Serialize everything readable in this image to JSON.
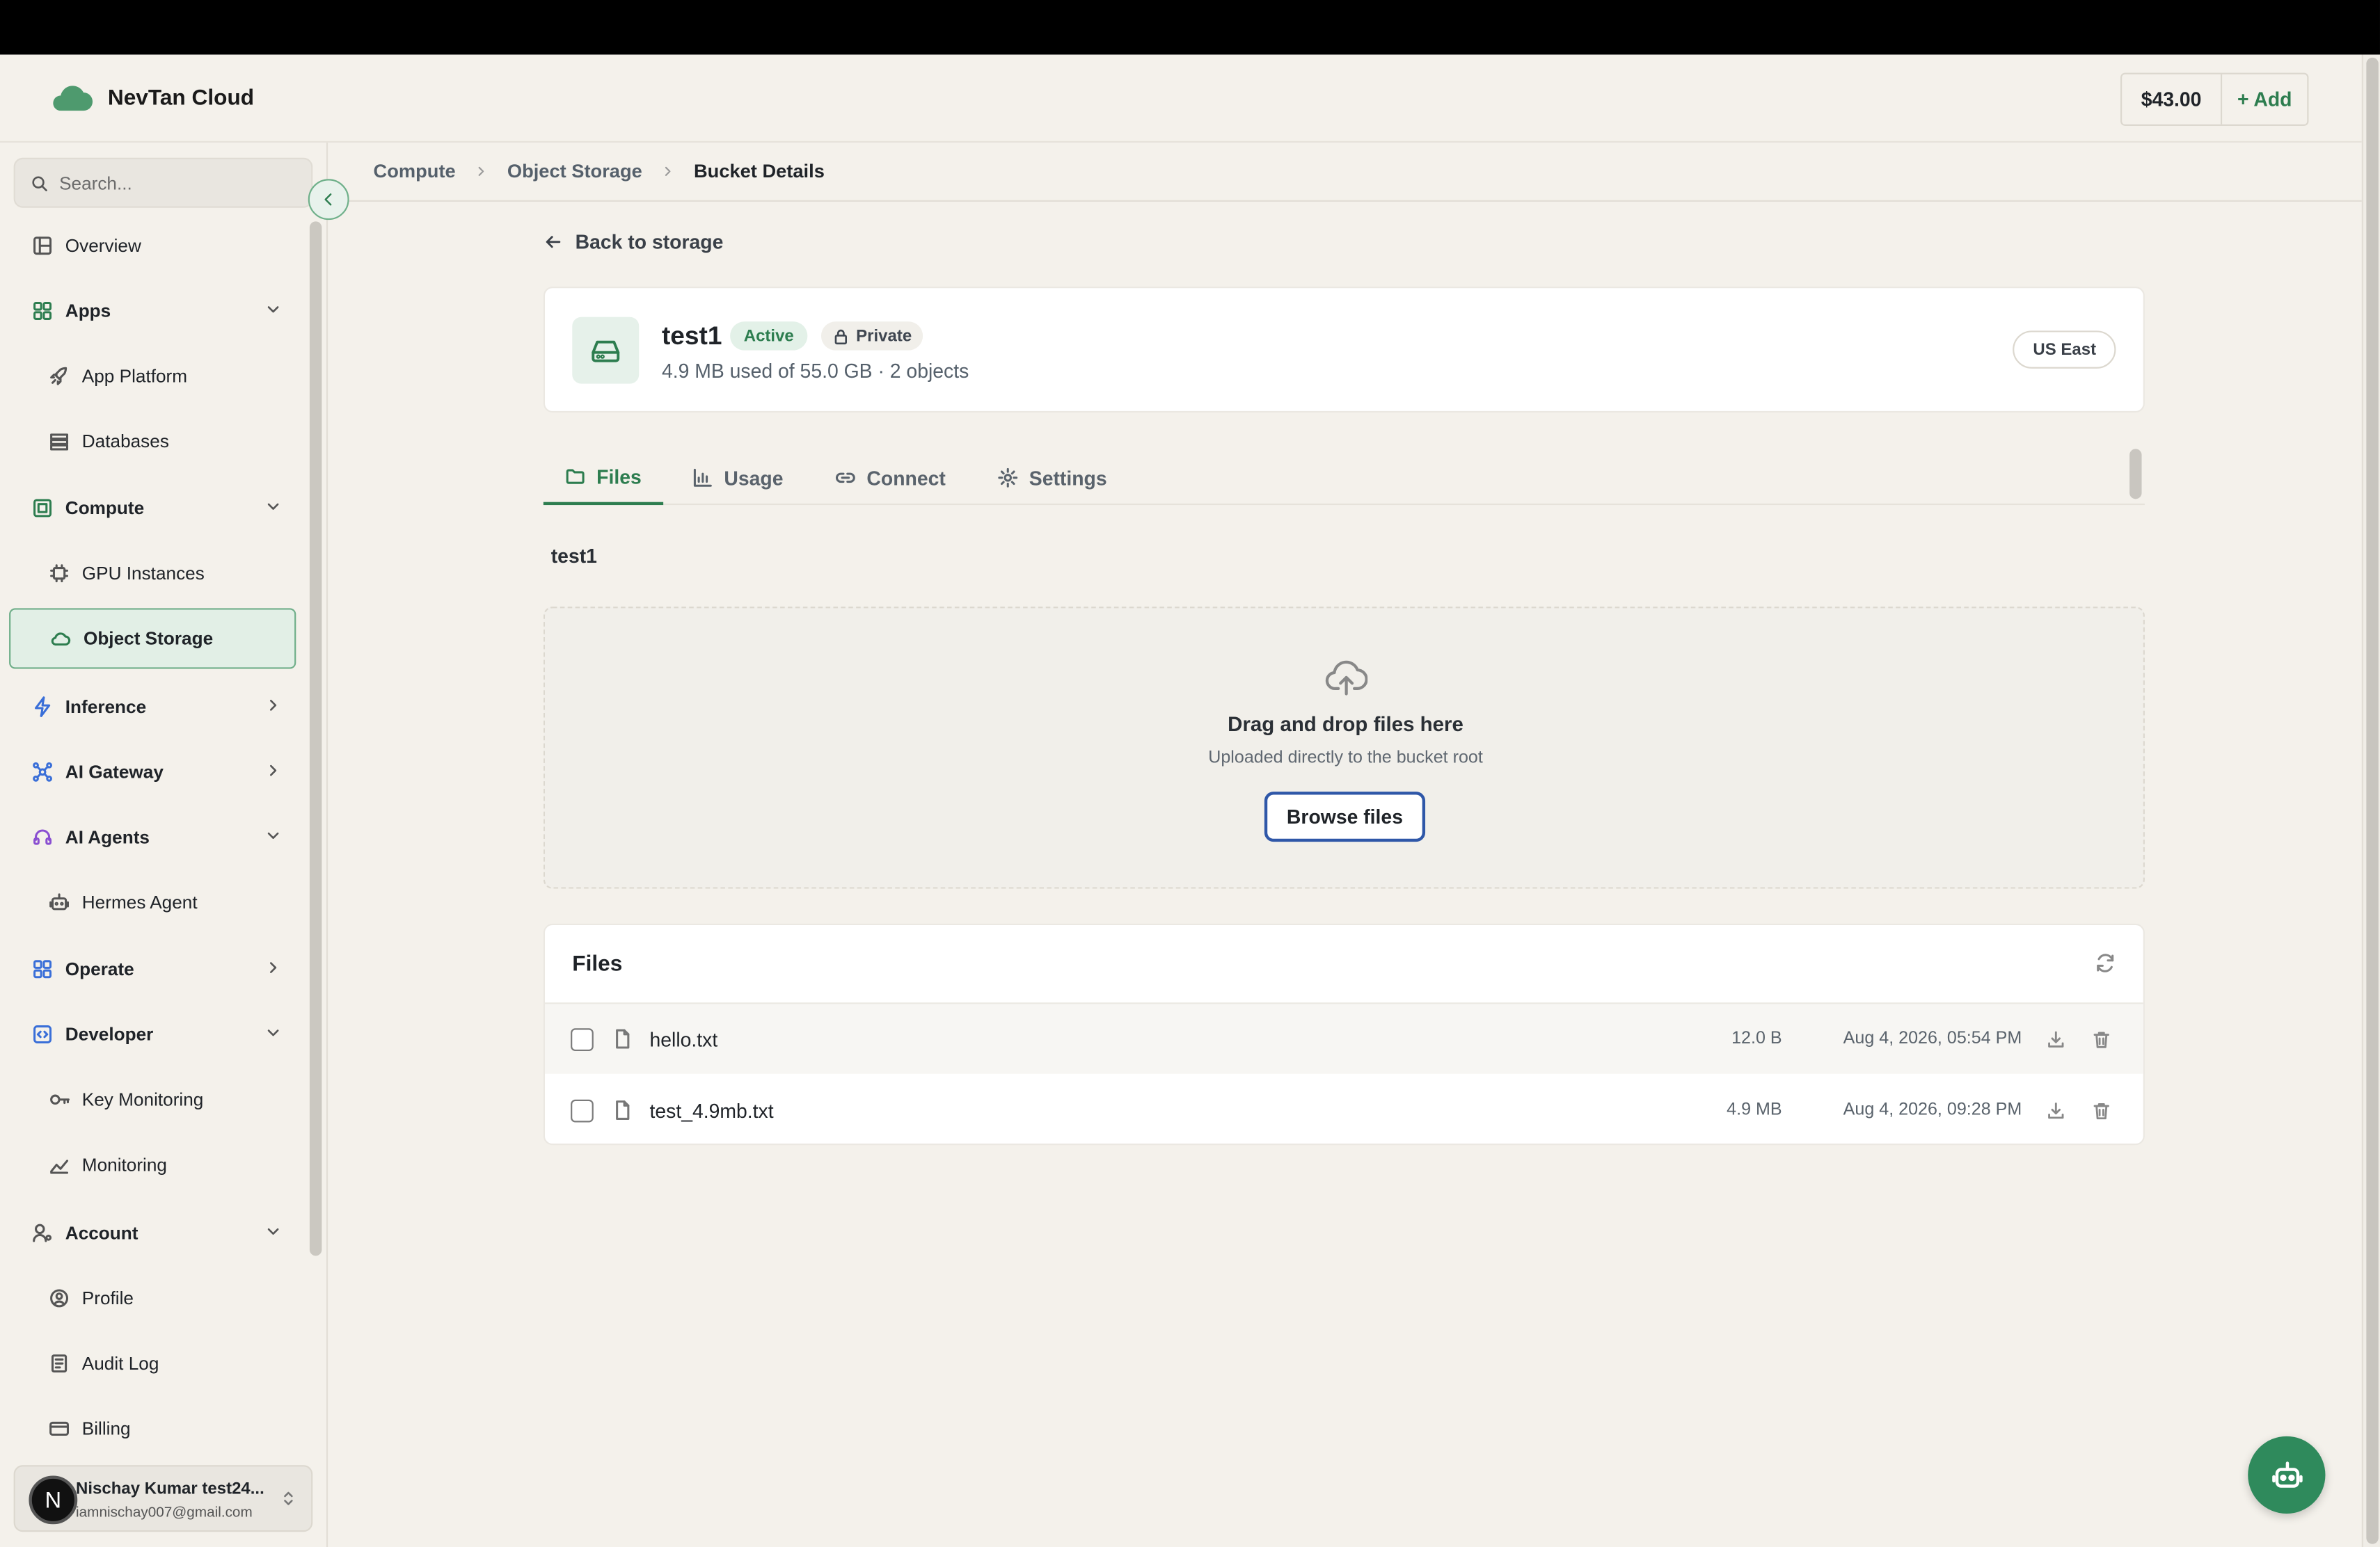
{
  "header": {
    "brand": "NevTan Cloud",
    "balance": "$43.00",
    "add_label": "+ Add"
  },
  "sidebar": {
    "search_placeholder": "Search...",
    "items": [
      {
        "label": "Overview"
      },
      {
        "label": "Apps"
      },
      {
        "label": "App Platform"
      },
      {
        "label": "Databases"
      },
      {
        "label": "Compute"
      },
      {
        "label": "GPU Instances"
      },
      {
        "label": "Object Storage"
      },
      {
        "label": "Inference"
      },
      {
        "label": "AI Gateway"
      },
      {
        "label": "AI Agents"
      },
      {
        "label": "Hermes Agent"
      },
      {
        "label": "Operate"
      },
      {
        "label": "Developer"
      },
      {
        "label": "Key Monitoring"
      },
      {
        "label": "Monitoring"
      },
      {
        "label": "Account"
      },
      {
        "label": "Profile"
      },
      {
        "label": "Audit Log"
      },
      {
        "label": "Billing"
      }
    ],
    "user": {
      "initial": "N",
      "name": "Nischay Kumar test24...",
      "email": "iamnischay007@gmail.com"
    }
  },
  "breadcrumb": [
    "Compute",
    "Object Storage",
    "Bucket Details"
  ],
  "back_label": "Back to storage",
  "bucket": {
    "name": "test1",
    "status": "Active",
    "visibility": "Private",
    "usage": "4.9 MB used of 55.0 GB · 2 objects",
    "region": "US East"
  },
  "tabs": [
    {
      "label": "Files"
    },
    {
      "label": "Usage"
    },
    {
      "label": "Connect"
    },
    {
      "label": "Settings"
    }
  ],
  "path_label": "test1",
  "dropzone": {
    "title": "Drag and drop files here",
    "subtitle": "Uploaded directly to the bucket root",
    "button": "Browse files"
  },
  "files": {
    "title": "Files",
    "rows": [
      {
        "name": "hello.txt",
        "size": "12.0 B",
        "date": "Aug 4, 2026, 05:54 PM"
      },
      {
        "name": "test_4.9mb.txt",
        "size": "4.9 MB",
        "date": "Aug 4, 2026, 09:28 PM"
      }
    ]
  },
  "colors": {
    "accent": "#2d7d4f",
    "background": "#f4f1eb"
  }
}
